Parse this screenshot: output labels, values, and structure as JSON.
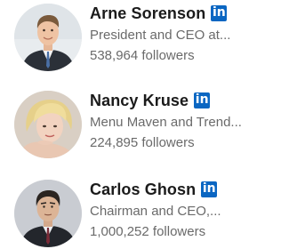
{
  "people": [
    {
      "name": "Arne Sorenson",
      "headline": "President and CEO at...",
      "followers": "538,964 followers",
      "badge_text": "in",
      "avatar_icon": "avatar-man-suit"
    },
    {
      "name": "Nancy Kruse",
      "headline": "Menu Maven and Trend...",
      "followers": "224,895 followers",
      "badge_text": "in",
      "avatar_icon": "avatar-woman-blonde"
    },
    {
      "name": "Carlos Ghosn",
      "headline": "Chairman and CEO,...",
      "followers": "1,000,252 followers",
      "badge_text": "in",
      "avatar_icon": "avatar-man-dark-hair"
    }
  ],
  "colors": {
    "linkedin_blue": "#0a66c2",
    "name_text": "#1b1b1b",
    "secondary_text": "#6a6a6a"
  }
}
